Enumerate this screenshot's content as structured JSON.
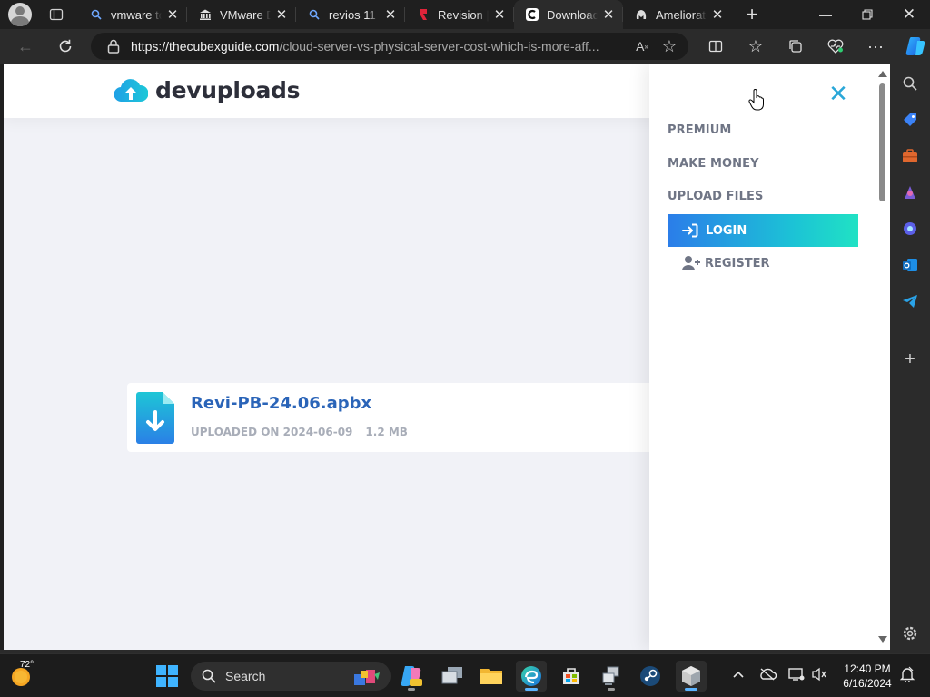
{
  "browser": {
    "tabs": [
      {
        "title": "vmware to",
        "icon": "search-icon",
        "active": false
      },
      {
        "title": "VMware D",
        "icon": "building-icon",
        "active": false
      },
      {
        "title": "revios 11 u",
        "icon": "search-icon",
        "active": false
      },
      {
        "title": "Revision |",
        "icon": "revision-logo-icon",
        "active": false
      },
      {
        "title": "Download",
        "icon": "cubexguide-icon",
        "active": true
      },
      {
        "title": "Ameliorate",
        "icon": "ameliorated-icon",
        "active": false
      }
    ],
    "url_host": "https://thecubexguide.com",
    "url_path": "/cloud-server-vs-physical-server-cost-which-is-more-aff..."
  },
  "site": {
    "logo_text": "devuploads",
    "file": {
      "name": "Revi-PB-24.06.apbx",
      "uploaded": "UPLOADED ON 2024-06-09",
      "size": "1.2 MB"
    },
    "menu": {
      "close": "✕",
      "premium": "PREMIUM",
      "make_money": "MAKE MONEY",
      "upload_files": "UPLOAD FILES",
      "login": "LOGIN",
      "register": "REGISTER"
    },
    "colors": {
      "accent": "#2aa7d8",
      "file_name": "#2a64b8",
      "login_start": "#2b7de9",
      "login_end": "#20e2c4"
    }
  },
  "taskbar": {
    "weather_temp": "72°",
    "search_placeholder": "Search",
    "time": "12:40 PM",
    "date": "6/16/2024"
  }
}
